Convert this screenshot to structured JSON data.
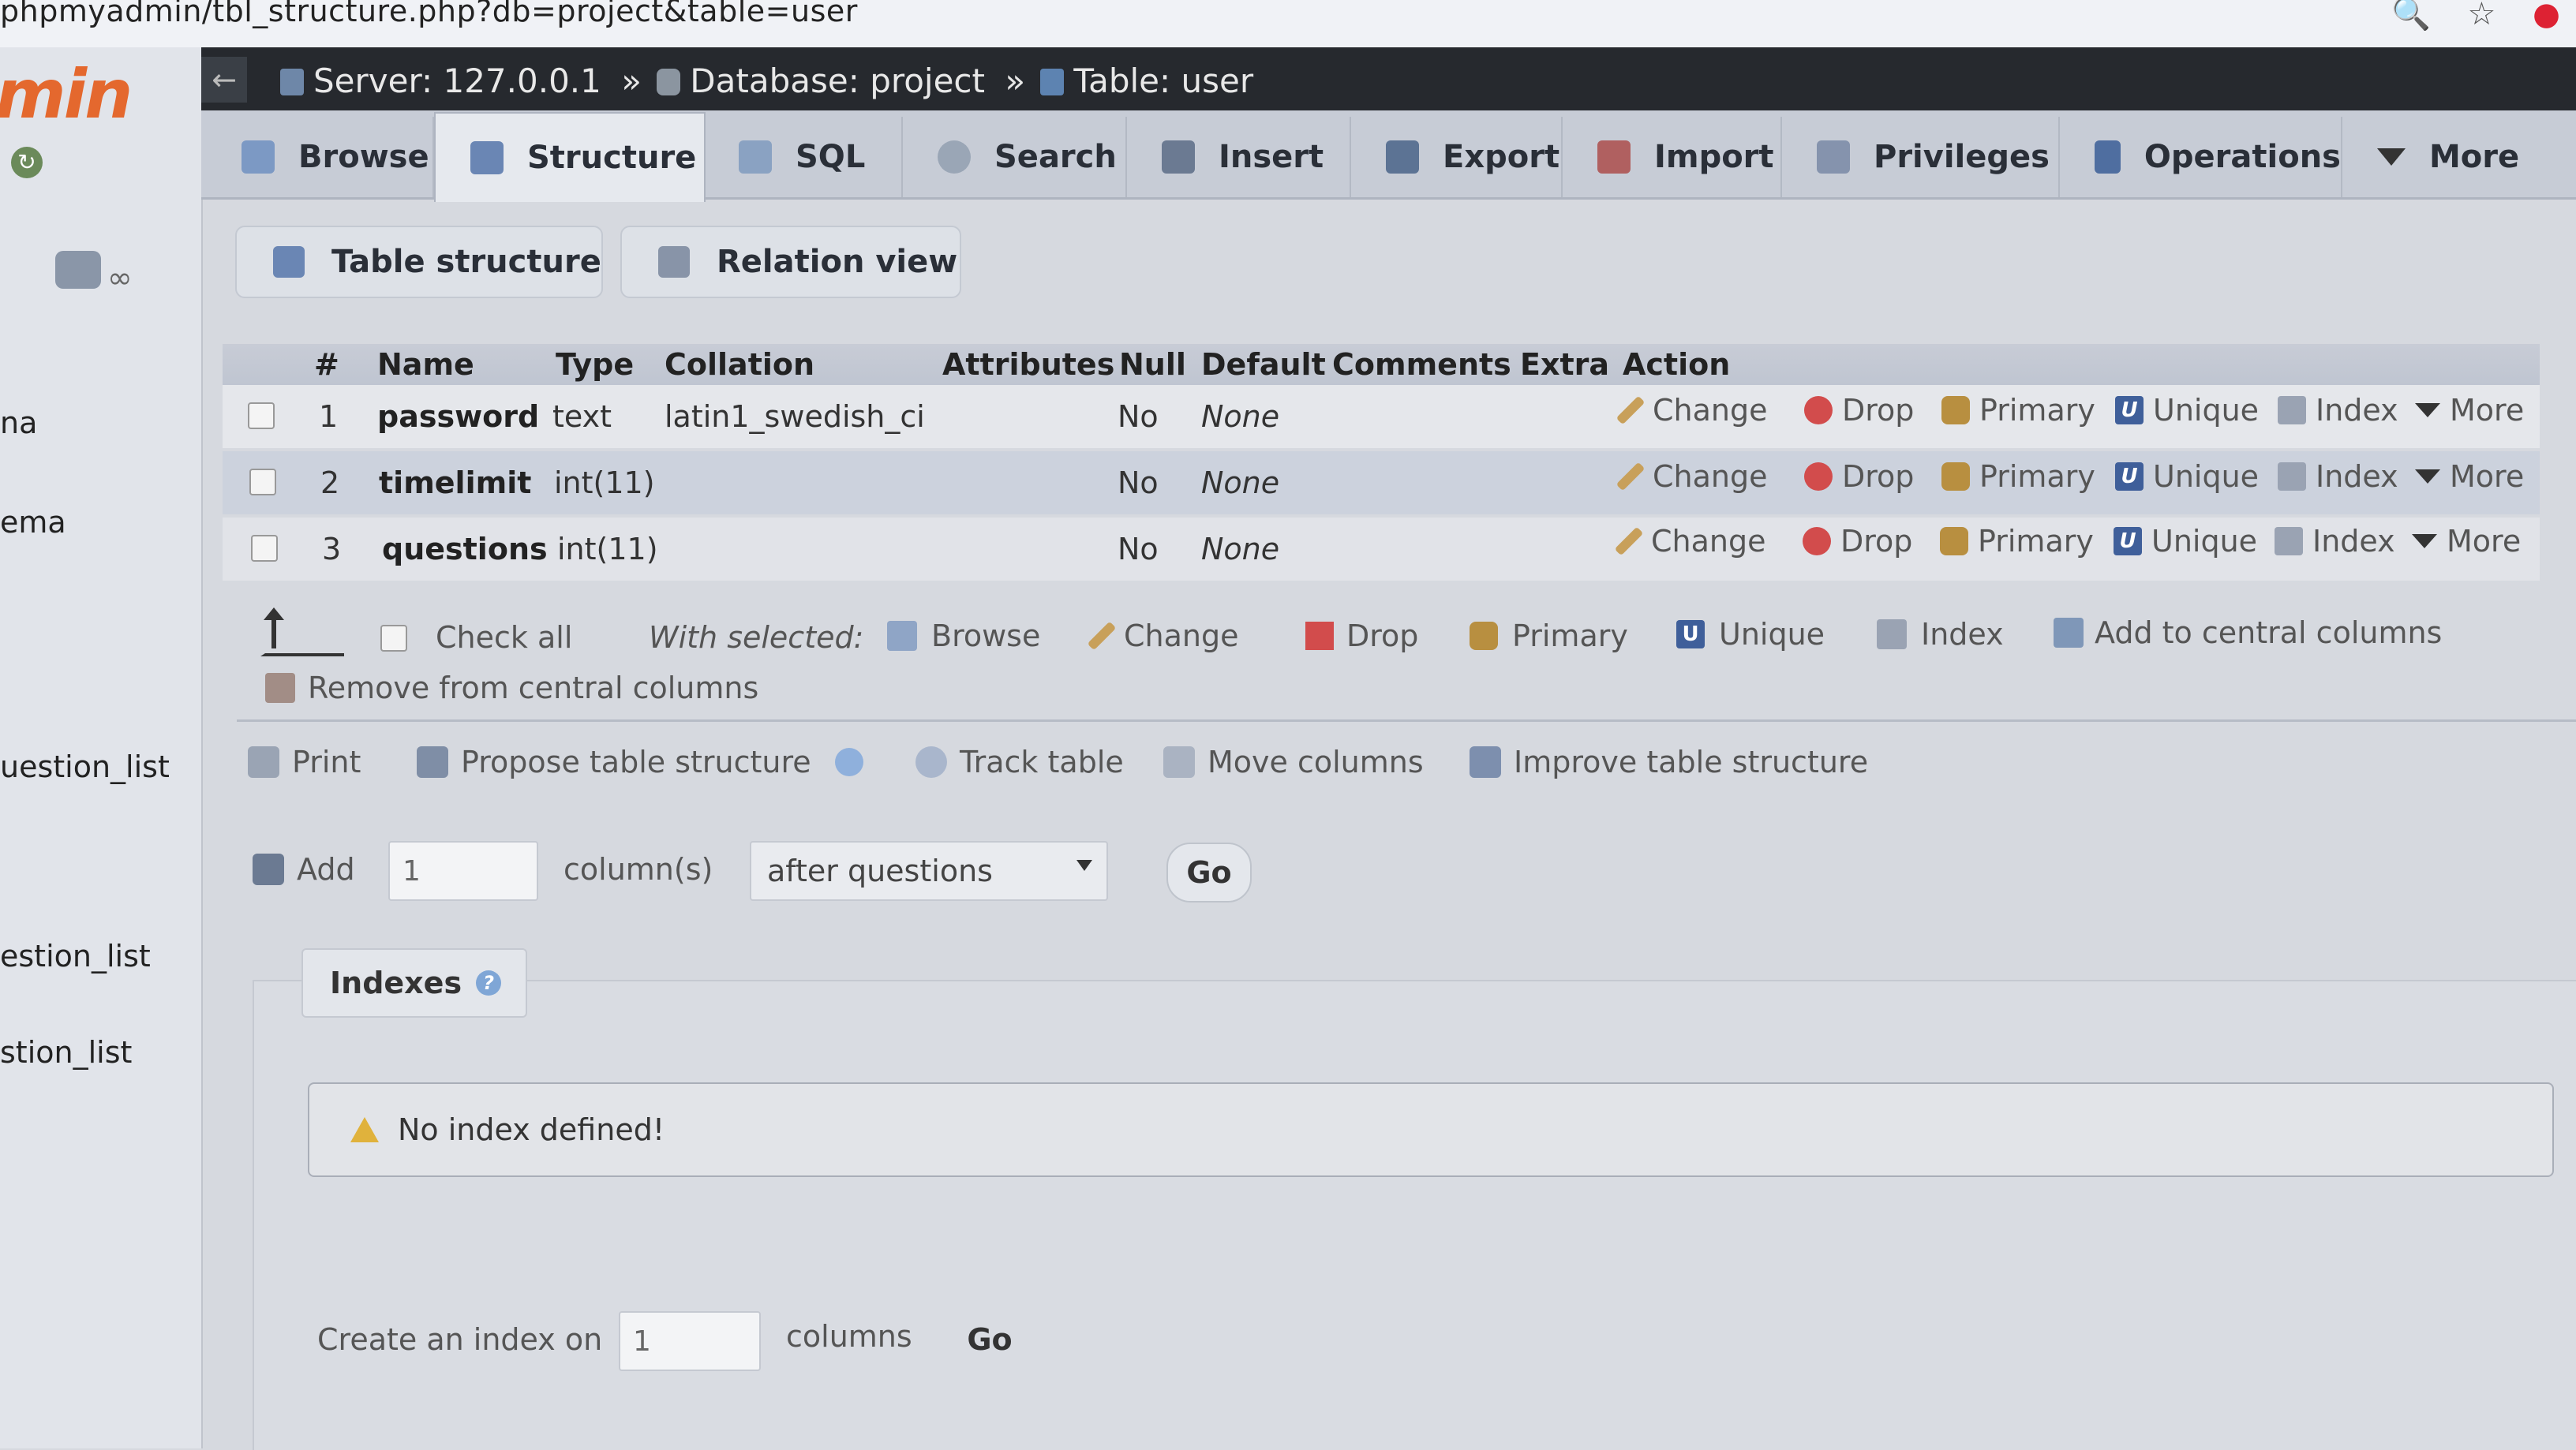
{
  "browser": {
    "url": "phpmyadmin/tbl_structure.php?db=project&table=user"
  },
  "sidebar": {
    "logo_text": "min",
    "nav_items": [
      "na",
      "ema",
      "uestion_list",
      "estion_list",
      "stion_list"
    ]
  },
  "breadcrumb": {
    "server": "Server: 127.0.0.1",
    "database": "Database: project",
    "table": "Table: user",
    "sep": "»"
  },
  "tabs": [
    "Browse",
    "Structure",
    "SQL",
    "Search",
    "Insert",
    "Export",
    "Import",
    "Privileges",
    "Operations",
    "More"
  ],
  "active_tab": "Structure",
  "subtabs": [
    "Table structure",
    "Relation view"
  ],
  "table": {
    "headers": [
      "#",
      "Name",
      "Type",
      "Collation",
      "Attributes",
      "Null",
      "Default",
      "Comments",
      "Extra",
      "Action"
    ],
    "rows": [
      {
        "num": "1",
        "name": "password",
        "type": "text",
        "collation": "latin1_swedish_ci",
        "null": "No",
        "default": "None"
      },
      {
        "num": "2",
        "name": "timelimit",
        "type": "int(11)",
        "collation": "",
        "null": "No",
        "default": "None"
      },
      {
        "num": "3",
        "name": "questions",
        "type": "int(11)",
        "collation": "",
        "null": "No",
        "default": "None"
      }
    ],
    "actions": {
      "change": "Change",
      "drop": "Drop",
      "primary": "Primary",
      "unique": "Unique",
      "index": "Index",
      "more": "More"
    }
  },
  "with_selected": {
    "check_all": "Check all",
    "label": "With selected:",
    "browse": "Browse",
    "change": "Change",
    "drop": "Drop",
    "primary": "Primary",
    "unique": "Unique",
    "index": "Index",
    "add_central": "Add to central columns",
    "remove_central": "Remove from central columns"
  },
  "tools": {
    "print": "Print",
    "propose": "Propose table structure",
    "track": "Track table",
    "move": "Move columns",
    "improve": "Improve table structure"
  },
  "add_columns": {
    "label": "Add",
    "count": "1",
    "unit": "column(s)",
    "position": "after questions",
    "go": "Go"
  },
  "indexes": {
    "legend": "Indexes",
    "notice": "No index defined!",
    "create_label": "Create an index on",
    "create_count": "1",
    "create_unit": "columns",
    "go": "Go"
  }
}
